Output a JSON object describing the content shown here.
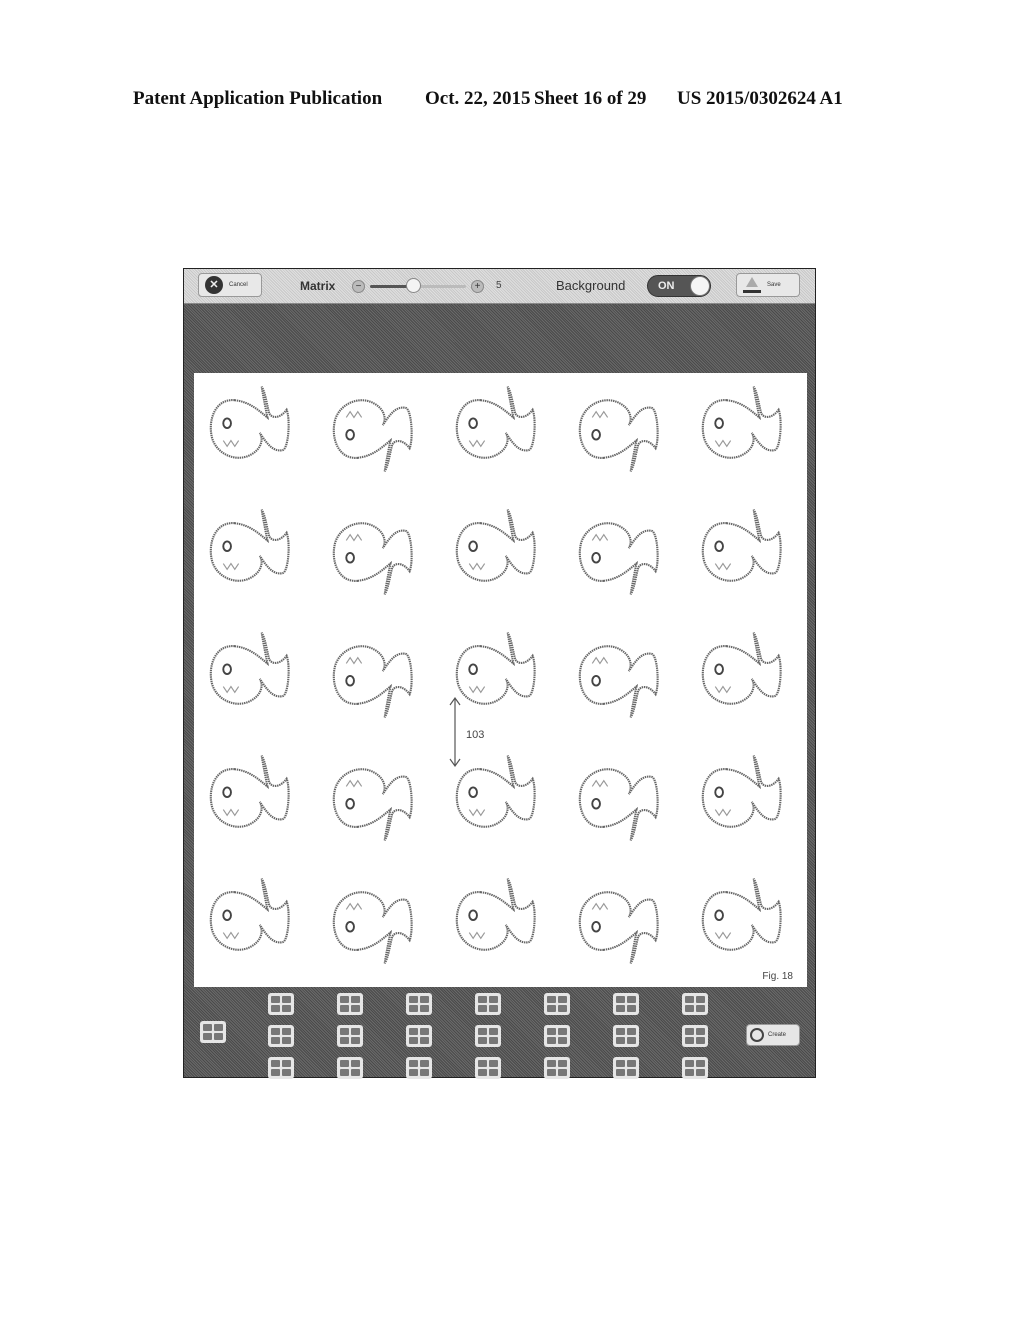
{
  "header": {
    "publication": "Patent Application Publication",
    "date": "Oct. 22, 2015",
    "sheet": "Sheet 16 of 29",
    "number": "US 2015/0302624 A1"
  },
  "toolbar": {
    "cancel_label": "Cancel",
    "matrix_label": "Matrix",
    "matrix_value": "5",
    "matrix_slider_fraction": 0.45,
    "background_label": "Background",
    "background_toggle": "ON",
    "save_label": "Save"
  },
  "canvas": {
    "grid_rows": 5,
    "grid_cols": 5,
    "pattern": [
      [
        "normal",
        "flipped",
        "normal",
        "flipped",
        "normal"
      ],
      [
        "normal",
        "flipped",
        "normal",
        "flipped",
        "normal"
      ],
      [
        "normal",
        "flipped",
        "normal",
        "flipped",
        "normal"
      ],
      [
        "normal",
        "flipped",
        "normal",
        "flipped",
        "normal"
      ],
      [
        "normal",
        "flipped",
        "normal",
        "flipped",
        "normal"
      ]
    ],
    "motif": "whale-icon",
    "annotation_label": "103",
    "figure_label": "Fig. 18"
  },
  "tray": {
    "layout_thumbnails_count": 22,
    "create_label": "Create"
  },
  "colors": {
    "frame": "#5a5a5a",
    "toolbar": "#d8d8d8",
    "canvas": "#ffffff"
  }
}
